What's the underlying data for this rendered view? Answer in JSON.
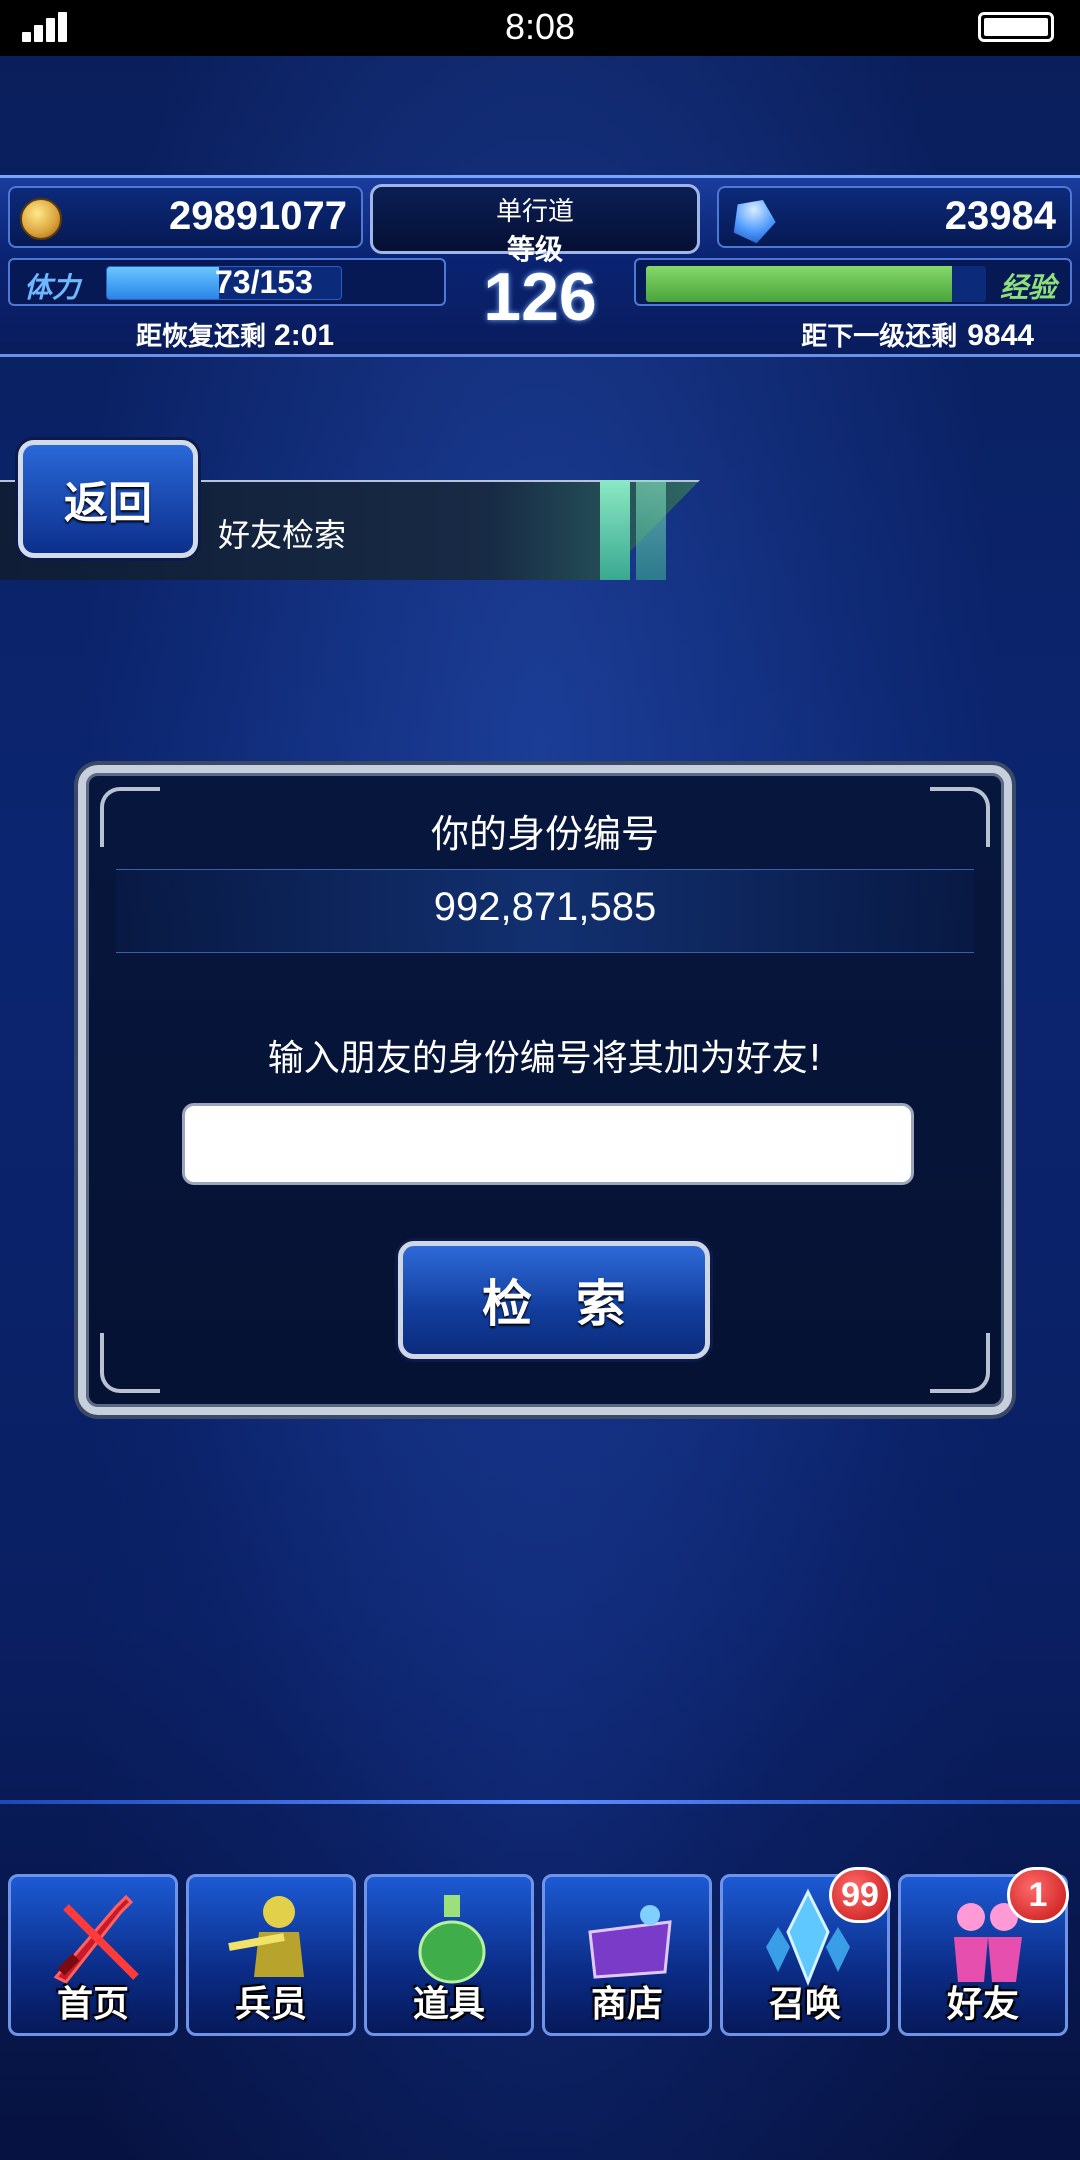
{
  "status_bar": {
    "time": "8:08"
  },
  "hud": {
    "gil": "29891077",
    "gems": "23984",
    "title": "单行道",
    "level_label": "等级",
    "level": "126",
    "stamina_label": "体力",
    "stamina_current": "73",
    "stamina_max": "/153",
    "stamina_fraction": 0.477,
    "exp_label": "经验",
    "exp_fraction": 0.9,
    "recover_label": "距恢复还剩",
    "recover_time": "2:01",
    "next_level_label": "距下一级还剩",
    "next_level_value": "9844"
  },
  "header": {
    "back_label": "返回",
    "page_title": "好友检索"
  },
  "panel": {
    "id_label": "你的身份编号",
    "id_value": "992,871,585",
    "prompt": "输入朋友的身份编号将其加为好友!",
    "input_value": "",
    "input_placeholder": "",
    "search_label": "检索"
  },
  "nav": {
    "items": [
      {
        "label": "首页",
        "icon": "sword-icon"
      },
      {
        "label": "兵员",
        "icon": "unit-icon"
      },
      {
        "label": "道具",
        "icon": "potion-icon"
      },
      {
        "label": "商店",
        "icon": "shop-icon"
      },
      {
        "label": "召唤",
        "icon": "crystal-icon",
        "badge": "99"
      },
      {
        "label": "好友",
        "icon": "friends-icon",
        "badge": "1"
      }
    ]
  },
  "colors": {
    "background": "#0b2570",
    "accent": "#2e6ad8",
    "stamina": "#2a85e8",
    "exp": "#4aa43c",
    "badge": "#c51414"
  }
}
